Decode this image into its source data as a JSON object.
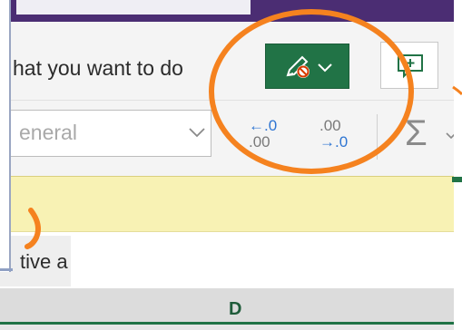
{
  "ribbon": {
    "tell_me_text": "hat you want to do",
    "number_format": "eneral",
    "increase_decimal": {
      "top": "←.0",
      "bottom": ".00"
    },
    "decrease_decimal": {
      "top": ".00",
      "bottom": "→.0"
    },
    "sum_symbol": "Σ"
  },
  "formula_bar": {
    "text": "tive a"
  },
  "grid": {
    "column_header": "D"
  },
  "colors": {
    "title_purple": "#4b2d73",
    "excel_green": "#217346",
    "protected_yellow": "#f8f2b4",
    "annotation_orange": "#f5821f"
  },
  "icons": {
    "editing_button": "pencil-no-edit-icon",
    "comment": "comment-icon",
    "sum": "autosum-icon"
  }
}
